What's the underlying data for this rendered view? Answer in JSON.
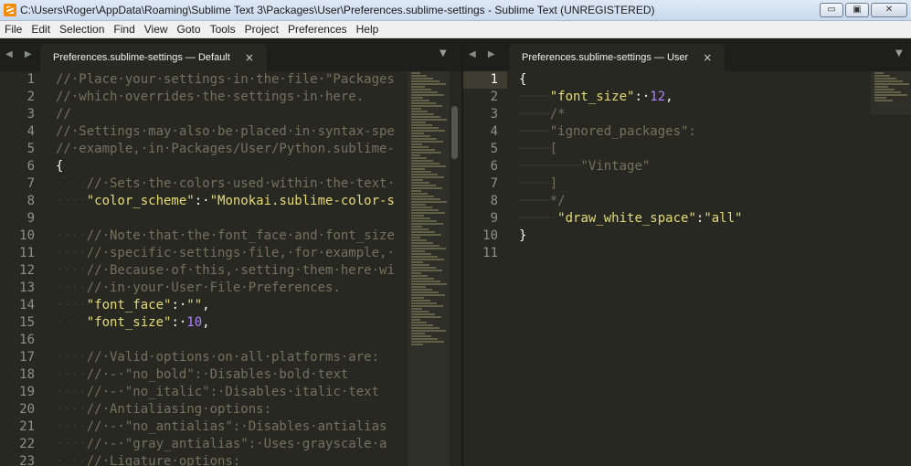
{
  "window": {
    "title": "C:\\Users\\Roger\\AppData\\Roaming\\Sublime Text 3\\Packages\\User\\Preferences.sublime-settings - Sublime Text (UNREGISTERED)",
    "minimize": "▭",
    "maximize": "▣",
    "close": "✕"
  },
  "menu": [
    "File",
    "Edit",
    "Selection",
    "Find",
    "View",
    "Goto",
    "Tools",
    "Project",
    "Preferences",
    "Help"
  ],
  "left_pane": {
    "tab_label": "Preferences.sublime-settings — Default",
    "tab_close": "×",
    "tab_nav": "◀ ▶",
    "dropdown": "▼",
    "line_numbers": [
      "1",
      "2",
      "3",
      "4",
      "5",
      "6",
      "7",
      "8",
      "9",
      "10",
      "11",
      "12",
      "13",
      "14",
      "15",
      "16",
      "17",
      "18",
      "19",
      "20",
      "21",
      "22",
      "23"
    ]
  },
  "right_pane": {
    "tab_label": "Preferences.sublime-settings — User",
    "tab_close": "×",
    "tab_nav": "◀ ▶",
    "dropdown": "▼",
    "line_numbers": [
      "1",
      "2",
      "3",
      "4",
      "5",
      "6",
      "7",
      "8",
      "9",
      "10",
      "11"
    ],
    "current_line": 1
  },
  "colors": {
    "background": "#272822",
    "comment": "#75715e",
    "string": "#e6db74",
    "number": "#ae81ff",
    "text": "#f8f8f2"
  }
}
